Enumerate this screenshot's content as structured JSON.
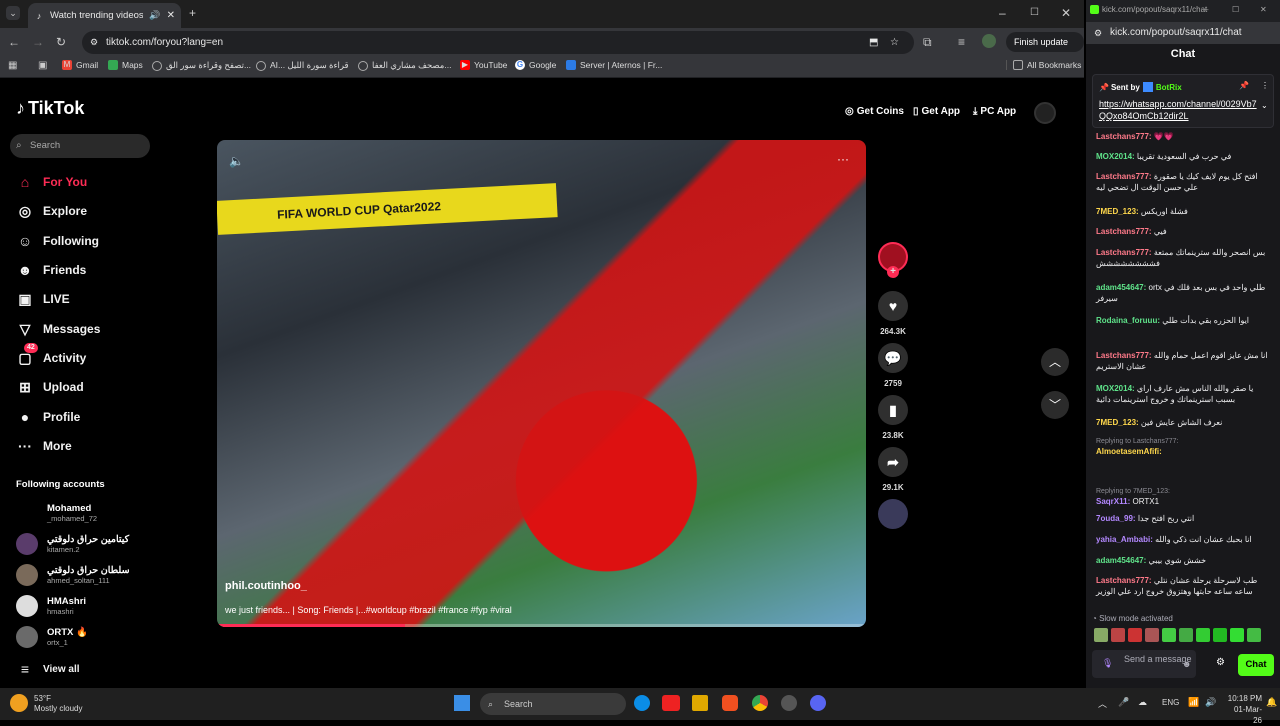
{
  "browser": {
    "tab_title": "Watch trending videos for y",
    "url": "tiktok.com/foryou?lang=en",
    "finish_update": "Finish update",
    "bookmarks": [
      "Gmail",
      "Maps",
      "تصفح وقراءة سور الق...",
      "AI...  قراءة سورة الليل",
      "مصحف مشاري العفا...",
      "YouTube",
      "Google",
      "Server | Aternos | Fr..."
    ],
    "all_bookmarks": "All Bookmarks"
  },
  "tiktok": {
    "logo": "TikTok",
    "search_placeholder": "Search",
    "nav": [
      "For You",
      "Explore",
      "Following",
      "Friends",
      "LIVE",
      "Messages",
      "Activity",
      "Upload",
      "Profile",
      "More"
    ],
    "activity_badge": "42",
    "header_buttons": [
      "Get Coins",
      "Get App",
      "PC App"
    ],
    "following_title": "Following accounts",
    "accounts": [
      {
        "name": "Mohamed",
        "handle": "_mohamed_72"
      },
      {
        "name": "كيتامين حراق دلوقتي",
        "handle": "kitamen.2"
      },
      {
        "name": "سلطان حراق دلوقتي",
        "handle": "ahmed_soltan_111"
      },
      {
        "name": "HMAshri",
        "handle": "hmashri"
      },
      {
        "name": "ORTX",
        "handle": "ortx_1"
      }
    ],
    "view_all": "View all",
    "video": {
      "author": "phil.coutinhoo_",
      "caption": "we just friends... | Song: Friends |...#worldcup #brazil #france #fyp #viral",
      "banner": "FIFA WORLD CUP Qatar2022",
      "progress": 0.29
    },
    "stats": {
      "likes": "264.3K",
      "comments": "2759",
      "saves": "23.8K",
      "shares": "29.1K"
    }
  },
  "popout": {
    "url": "kick.com/popout/saqrx11/chat",
    "title": "Chat",
    "pinned_by": "Sent by",
    "pinned_user": "BotRix",
    "pinned_link": "https://whatsapp.com/channel/0029Vb7QQxo84OmCb12dir2L",
    "messages": [
      {
        "user": "Lastchans777:",
        "text": "💗💗",
        "color": "#ff7a8a"
      },
      {
        "user": "MOX2014:",
        "text": "في حرب في السعودية تقريبا",
        "color": "#5fe38a"
      },
      {
        "user": "Lastchans777:",
        "text": "افتح كل يوم لايف كيك يا صقورة علي حسن الوقت ال تضحي ليه",
        "color": "#ff7a8a"
      },
      {
        "user": "7MED_123:",
        "text": "فشلة اوريكس",
        "color": "#ffd84d"
      },
      {
        "user": "Lastchans777:",
        "text": "فيي",
        "color": "#ff7a8a"
      },
      {
        "user": "Lastchans777:",
        "text": "بس انصحر والله سترينماتك ممتعة فشششششششش",
        "color": "#ff7a8a"
      },
      {
        "user": "adam454647:",
        "text": "ortx طلي واحد في بس بعد قلك في سيرفر",
        "color": "#5fe38a"
      },
      {
        "user": "Rodaina_foruuu:",
        "text": "ايوا الحزره بقي بدأت طلي",
        "color": "#5fe38a"
      },
      {
        "user": "Lastchans777:",
        "text": "انا مش عايز اقوم اعمل حمام والله عشان الاستريم",
        "color": "#ff7a8a"
      },
      {
        "user": "MOX2014:",
        "text": "يا صقر والله الناس مش عارف اراي بسبب استرينماتك و خروج استرينمات دائية",
        "color": "#5fe38a"
      },
      {
        "user": "7MED_123:",
        "text": "نعرف الشاش عايش فين",
        "color": "#ffd84d"
      },
      {
        "user": "AlmoetasemAfifi:",
        "text": "",
        "color": "#ffd84d",
        "reply": "Replying to Lastchans777:"
      },
      {
        "user": "SaqrX11:",
        "text": "ORTX1",
        "color": "#b388ff",
        "reply": "Replying to 7MED_123:"
      },
      {
        "user": "7ouda_99:",
        "text": "انتي ربح افتح جدا",
        "color": "#b388ff"
      },
      {
        "user": "yahia_Ambabi:",
        "text": "انا بحبك عشان انت ذكي والله",
        "color": "#b388ff"
      },
      {
        "user": "adam454647:",
        "text": "خشش شوي بيبي",
        "color": "#5fe38a"
      },
      {
        "user": "Lastchans777:",
        "text": "طب لاسرحلة يرحلة عشان نتلي ساعه ساعه حابتها وهتزوق خروج ارد علي الوزير",
        "color": "#ff7a8a"
      }
    ],
    "slow_mode": "Slow mode activated",
    "send_placeholder": "Send a message",
    "chat_button": "Chat"
  },
  "taskbar": {
    "temp": "53°F",
    "weather": "Mostly cloudy",
    "search": "Search",
    "lang": "ENG",
    "time": "10:18 PM",
    "date": "01-Mar-26"
  },
  "colors": {
    "tiktok_red": "#fe2c55",
    "kick_green": "#53fc18",
    "chrome_bg": "#35363a"
  }
}
